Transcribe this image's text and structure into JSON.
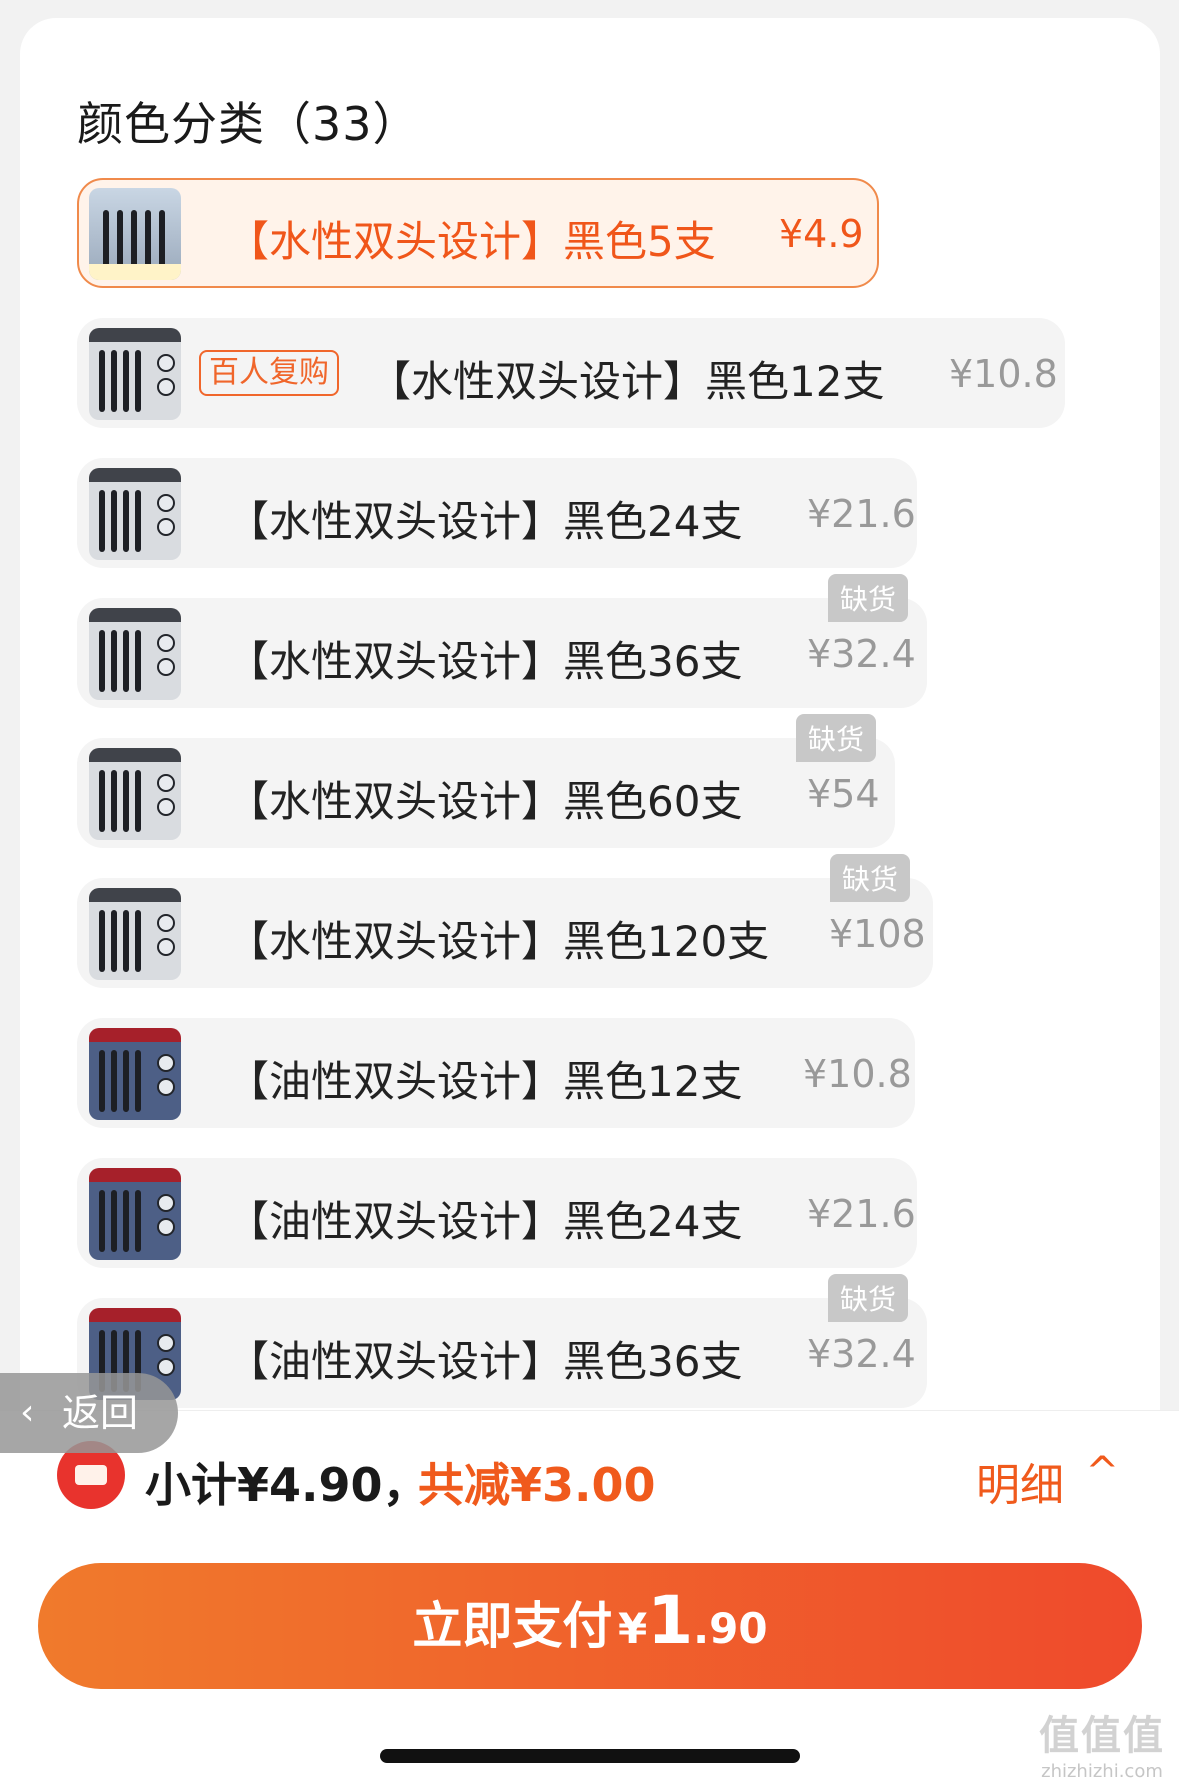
{
  "section_title": "颜色分类（33）",
  "options": [
    {
      "label": "【水性双头设计】黑色5支",
      "price": "¥4.9",
      "selected": true
    },
    {
      "label": "【水性双头设计】黑色12支",
      "price": "¥10.8",
      "badge": "百人复购"
    },
    {
      "label": "【水性双头设计】黑色24支",
      "price": "¥21.6"
    },
    {
      "label": "【水性双头设计】黑色36支",
      "price": "¥32.4",
      "soldout": "缺货"
    },
    {
      "label": "【水性双头设计】黑色60支",
      "price": "¥54",
      "soldout": "缺货"
    },
    {
      "label": "【水性双头设计】黑色120支",
      "price": "¥108",
      "soldout": "缺货"
    },
    {
      "label": "【油性双头设计】黑色12支",
      "price": "¥10.8"
    },
    {
      "label": "【油性双头设计】黑色24支",
      "price": "¥21.6"
    },
    {
      "label": "【油性双头设计】黑色36支",
      "price": "¥32.4",
      "soldout": "缺货"
    }
  ],
  "back": {
    "label": "返回"
  },
  "summary": {
    "subtotal": "小计¥4.90，",
    "saved": "共减¥3.00",
    "detail_label": "明细",
    "detail_chevron": "^"
  },
  "pay_button": {
    "label": "立即支付",
    "currency": "¥",
    "amount_int": "1",
    "amount_dec": ".90"
  },
  "watermark": {
    "logo": "值值值",
    "url": "zhizhizhi.com"
  },
  "colors": {
    "accent": "#f0561a",
    "button_start": "#f07a2c",
    "button_end": "#ef4a2c",
    "soldout": "#c8c8c8"
  }
}
